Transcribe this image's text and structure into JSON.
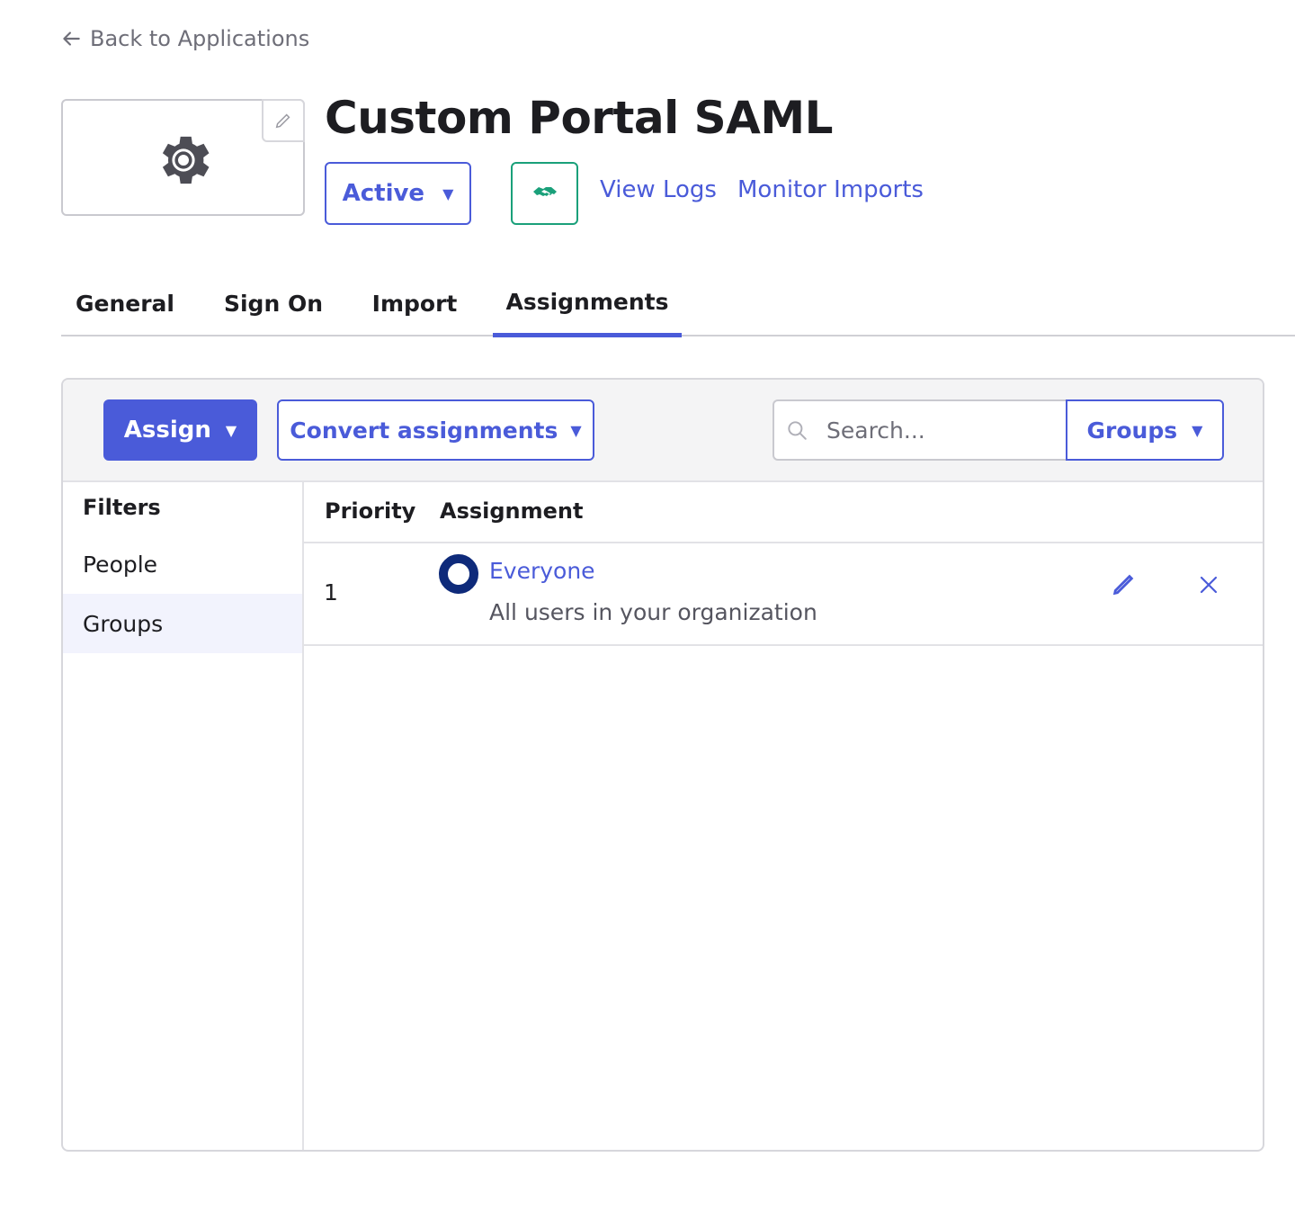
{
  "nav": {
    "back_label": "Back to Applications"
  },
  "app": {
    "title": "Custom Portal SAML",
    "status": "Active",
    "links": {
      "view_logs": "View Logs",
      "monitor_imports": "Monitor Imports"
    }
  },
  "tabs": [
    {
      "label": "General",
      "active": false
    },
    {
      "label": "Sign On",
      "active": false
    },
    {
      "label": "Import",
      "active": false
    },
    {
      "label": "Assignments",
      "active": true
    }
  ],
  "toolbar": {
    "assign_label": "Assign",
    "convert_label": "Convert assignments",
    "search_placeholder": "Search...",
    "search_value": "",
    "type_select": "Groups"
  },
  "filters": {
    "title": "Filters",
    "items": [
      {
        "label": "People",
        "selected": false
      },
      {
        "label": "Groups",
        "selected": true
      }
    ]
  },
  "table": {
    "columns": [
      "Priority",
      "Assignment"
    ],
    "rows": [
      {
        "priority": "1",
        "name": "Everyone",
        "description": "All users in your organization"
      }
    ]
  },
  "icons": {
    "back": "arrow-left-icon",
    "logo": "gear-icon",
    "logo_edit": "pencil-icon",
    "provisioning": "handshake-icon",
    "search": "search-icon",
    "group": "group-icon",
    "edit": "pencil-icon",
    "remove": "close-icon"
  },
  "colors": {
    "accent": "#4a5bd9",
    "provision": "#1aa07a",
    "group_icon": "#0e2a7a",
    "selected_filter_bg": "#f2f3fd"
  }
}
